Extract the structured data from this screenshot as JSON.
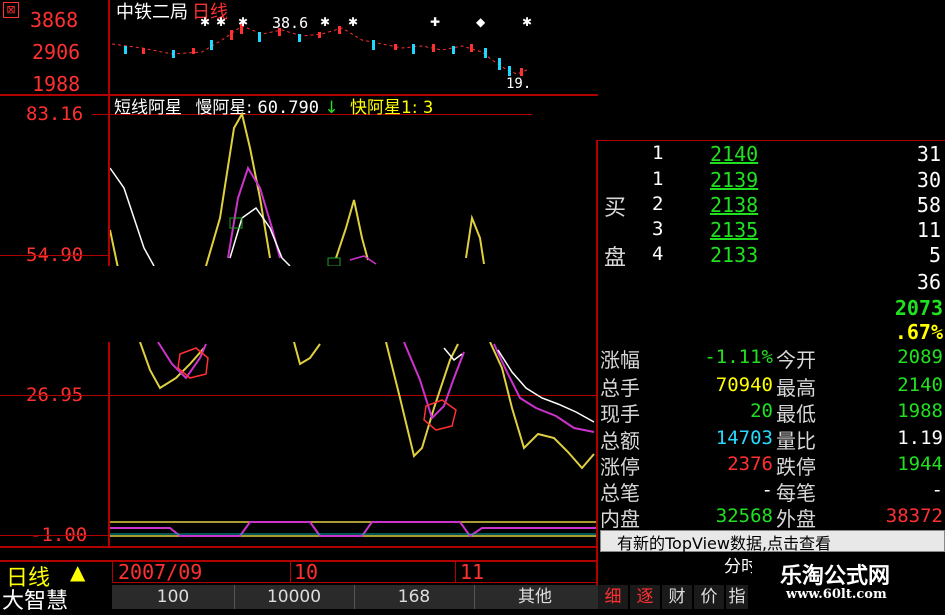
{
  "header": {
    "stock_name": "中铁二局",
    "period": "日线",
    "marker_value": "38.6",
    "small_label": "19."
  },
  "price_axis": {
    "top": "3868",
    "mid": "2906",
    "bottom": "1988"
  },
  "indicator": {
    "name": "短线阿星",
    "slow_label": "慢阿星:",
    "slow_value": "60.790",
    "slow_arrow": "↓",
    "fast_label": "快阿星1:",
    "fast_value": "3"
  },
  "indicator_axis": {
    "v1": "83.16",
    "v2": "54.90",
    "v3": "26.95",
    "v4": "-1.00"
  },
  "order_book": {
    "buy_label_1": "买",
    "buy_label_2": "盘",
    "rows": [
      {
        "level": "1",
        "price": "2140",
        "volume": "31"
      },
      {
        "level": "1",
        "price": "2139",
        "volume": "30"
      },
      {
        "level": "2",
        "price": "2138",
        "volume": "58"
      },
      {
        "level": "3",
        "price": "2135",
        "volume": "11"
      },
      {
        "level": "4",
        "price": "2133",
        "volume": "5"
      }
    ],
    "extra_volume": "36",
    "current_price": "2073",
    "change_pct_partial": ".67%"
  },
  "stats": {
    "change_pct_label": "涨幅",
    "change_pct_value": "-1.11%",
    "open_label": "今开",
    "open_value": "2089",
    "total_vol_label": "总手",
    "total_vol_value": "70940",
    "high_label": "最高",
    "high_value": "2140",
    "current_vol_label": "现手",
    "current_vol_value": "20",
    "low_label": "最低",
    "low_value": "1988",
    "amount_label": "总额",
    "amount_value": "14703",
    "vol_ratio_label": "量比",
    "vol_ratio_value": "1.19",
    "limit_up_label": "涨停",
    "limit_up_value": "2376",
    "limit_down_label": "跌停",
    "limit_down_value": "1944",
    "trades_label": "总笔",
    "trades_value": "-",
    "per_trade_label": "每笔",
    "per_trade_value": "-",
    "inner_label": "内盘",
    "inner_value": "32568",
    "outer_label": "外盘",
    "outer_value": "38372"
  },
  "notice": {
    "text": "有新的TopView数据,点击查看"
  },
  "timeline": {
    "month1": "2007/09",
    "month2": "10",
    "month3": "11"
  },
  "footer": {
    "period_label": "日线",
    "app_name": "大智慧",
    "tabs": [
      "100",
      "10000",
      "168",
      "其他"
    ],
    "right_tabs": [
      "细",
      "逐",
      "财",
      "价",
      "指"
    ],
    "fenshi": "分时",
    "watermark_title": "乐淘公式网",
    "watermark_url": "www.60lt.com"
  },
  "colors": {
    "axis_red": "#b00000",
    "label_red": "#ff3030",
    "slow_line": "#cc33cc",
    "fast_line": "#e0d040",
    "white_line": "#ffffff"
  }
}
